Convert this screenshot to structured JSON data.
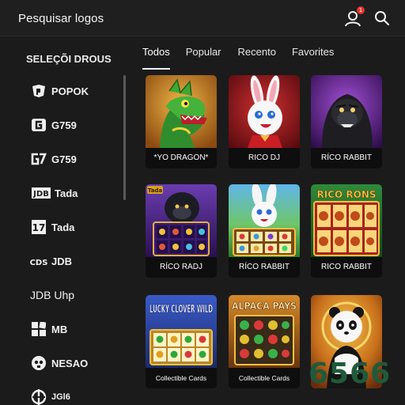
{
  "header": {
    "search_label": "Pesquisar logos",
    "notification_count": "1",
    "icons": [
      "user-icon",
      "search-icon"
    ]
  },
  "sidebar": {
    "title": "SELEÇÕI DROUS",
    "items": [
      {
        "label": "POPOK",
        "icon": "popok-logo-icon"
      },
      {
        "label": "G759",
        "icon": "g-logo-icon"
      },
      {
        "label": "G759",
        "icon": "g7-logo-icon"
      },
      {
        "label": "Tada",
        "icon": "jdb-logo-icon",
        "icon_text": "JDB"
      },
      {
        "label": "Tada",
        "icon": "tada-logo-icon",
        "icon_text": "17"
      },
      {
        "label": "JDB",
        "icon": "cq-logo-icon",
        "icon_text": "CDS"
      },
      {
        "label": "JDB Uhp",
        "icon": ""
      },
      {
        "label": "MB",
        "icon": "mb-logo-icon"
      },
      {
        "label": "NESAO",
        "icon": "skull-logo-icon"
      },
      {
        "label": "JGl6",
        "icon": "jg-logo-icon"
      }
    ]
  },
  "tabs": [
    {
      "label": "Todos",
      "active": true
    },
    {
      "label": "Popular",
      "active": false
    },
    {
      "label": "Recento",
      "active": false
    },
    {
      "label": "Favorites",
      "active": false
    }
  ],
  "games": [
    {
      "caption": "*YO DRAGON*",
      "art": "dragon"
    },
    {
      "caption": "RICO DJ",
      "art": "rabbit-red"
    },
    {
      "caption": "RÍCO RABBIT",
      "art": "gorilla-purple"
    },
    {
      "caption": "RÍCO RADJ",
      "art": "gorilla-slots",
      "badge_text": "Tada"
    },
    {
      "caption": "RÍCO RABBIT",
      "art": "rabbit-slots"
    },
    {
      "caption": "RICO RABBIT",
      "art": "rico-rons",
      "title_text": "RICO RONS"
    },
    {
      "caption": "Collectible Cards",
      "art": "lucky-clover",
      "title_text": "LUCKY CLOVER WILD"
    },
    {
      "caption": "Collectible Cards",
      "art": "alpaca",
      "title_text": "ALPACA PAYS"
    },
    {
      "caption": "",
      "art": "panda"
    }
  ],
  "watermark": "6566"
}
